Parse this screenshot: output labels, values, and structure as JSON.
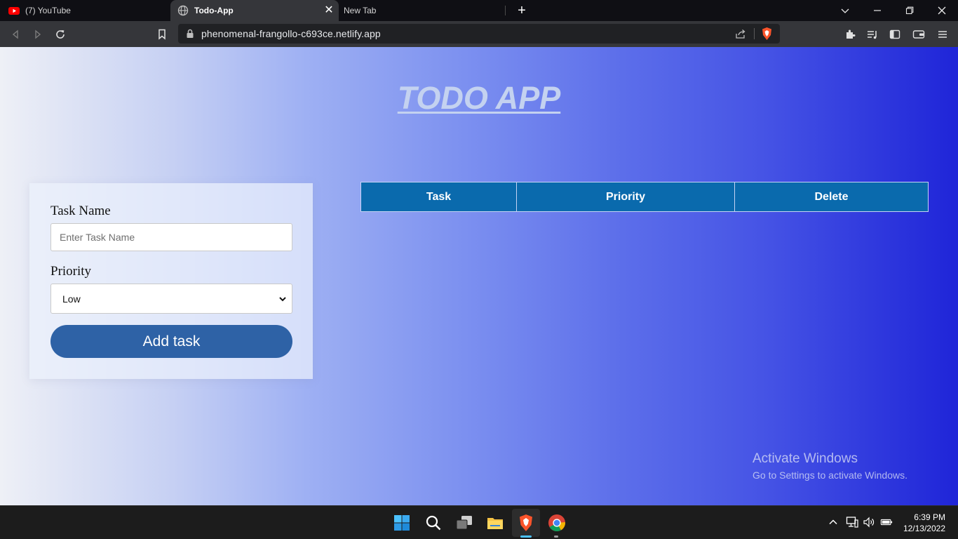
{
  "browser": {
    "tabs": [
      {
        "label": "(7) YouTube",
        "icon": "youtube-icon",
        "active": false
      },
      {
        "label": "Todo-App",
        "icon": "globe-icon",
        "active": true
      },
      {
        "label": "New Tab",
        "icon": "",
        "active": false
      }
    ],
    "url": "phenomenal-frangollo-c693ce.netlify.app"
  },
  "app": {
    "title": "TODO APP",
    "form": {
      "task_label": "Task Name",
      "task_placeholder": "Enter Task Name",
      "task_value": "",
      "priority_label": "Priority",
      "priority_selected": "Low",
      "add_button": "Add task"
    },
    "table": {
      "headers": [
        "Task",
        "Priority",
        "Delete"
      ],
      "rows": []
    }
  },
  "watermark": {
    "line1": "Activate Windows",
    "line2": "Go to Settings to activate Windows."
  },
  "taskbar": {
    "time": "6:39 PM",
    "date": "12/13/2022"
  },
  "colors": {
    "header_bg": "#0a6aad",
    "button_bg": "#2e62a6",
    "title_color": "#c4d2f0",
    "brave_accent": "#fb542b"
  }
}
